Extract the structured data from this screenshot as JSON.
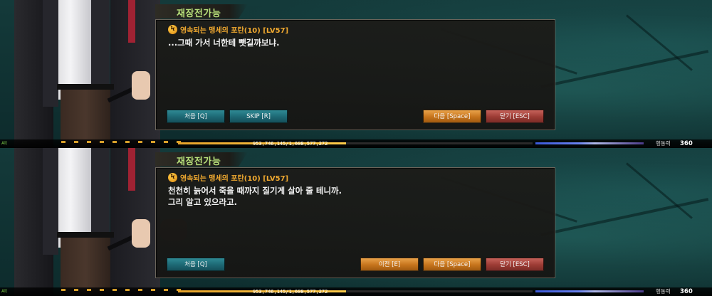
{
  "panels": [
    {
      "tag_label": "재장전가능",
      "quest_icon_glyph": "Ϟ",
      "quest_title": "영속되는 맹세의 포탄(10) [LV57]",
      "lines": [
        "...그때 가서 너한테 뺏길까보냐.",
        ""
      ],
      "buttons": {
        "first": "처음 [Q]",
        "skip": "SKIP [R]",
        "next": "다음 [Space]",
        "close": "닫기 [ESC]"
      },
      "hud": {
        "alt": "Alt",
        "exp": "953,746,145/1,608,577,272",
        "ap_label": "행동력",
        "ap_value": "360"
      }
    },
    {
      "tag_label": "재장전가능",
      "quest_icon_glyph": "Ϟ",
      "quest_title": "영속되는 맹세의 포탄(10) [LV57]",
      "lines": [
        "천천히 늙어서 죽을 때까지 질기게 살아 줄 테니까.",
        "그리 알고 있으라고."
      ],
      "buttons": {
        "first": "처음 [Q]",
        "prev": "이전 [E]",
        "next": "다음 [Space]",
        "close": "닫기 [ESC]"
      },
      "hud": {
        "alt": "Alt",
        "exp": "953,746,145/1,608,577,272",
        "ap_label": "행동력",
        "ap_value": "360"
      }
    }
  ],
  "colors": {
    "tag": "#b7e07a",
    "quest_title": "#f0a930",
    "teal_button": "#1d6874",
    "orange_button": "#c6741c",
    "red_button": "#9c3b34"
  }
}
